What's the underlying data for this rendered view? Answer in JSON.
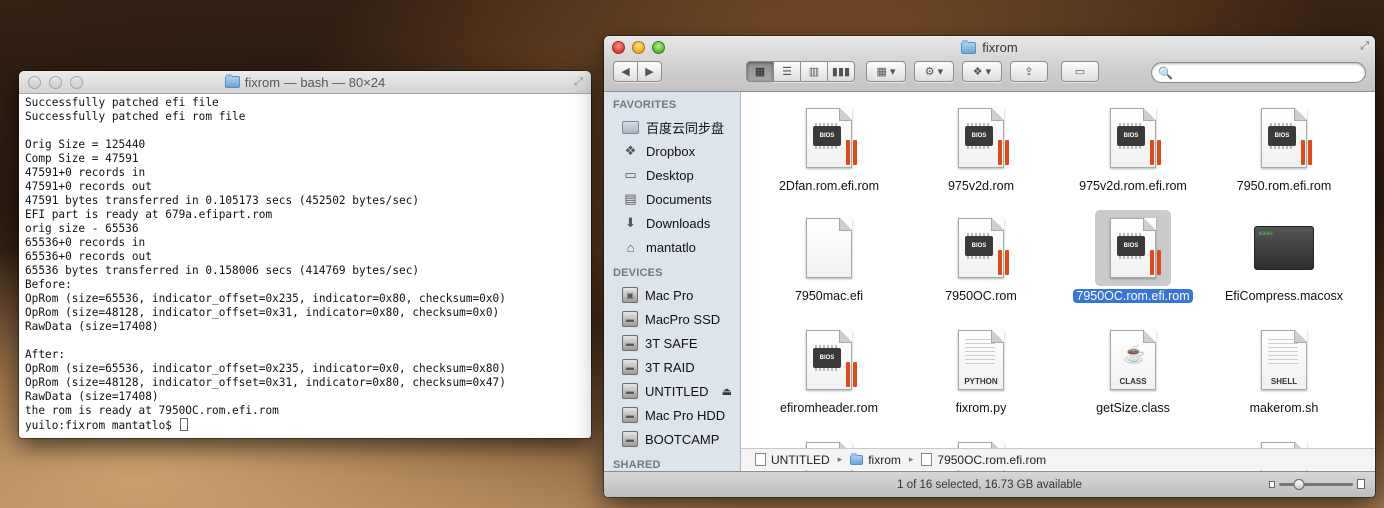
{
  "terminal": {
    "title": "fixrom — bash — 80×24",
    "lines": [
      "Successfully patched efi file",
      "Successfully patched efi rom file",
      "",
      "Orig Size = 125440",
      "Comp Size = 47591",
      "47591+0 records in",
      "47591+0 records out",
      "47591 bytes transferred in 0.105173 secs (452502 bytes/sec)",
      "EFI part is ready at 679a.efipart.rom",
      "orig size - 65536",
      "65536+0 records in",
      "65536+0 records out",
      "65536 bytes transferred in 0.158006 secs (414769 bytes/sec)",
      "Before:",
      "OpRom (size=65536, indicator_offset=0x235, indicator=0x80, checksum=0x0)",
      "OpRom (size=48128, indicator_offset=0x31, indicator=0x80, checksum=0x0)",
      "RawData (size=17408)",
      "",
      "After:",
      "OpRom (size=65536, indicator_offset=0x235, indicator=0x0, checksum=0x80)",
      "OpRom (size=48128, indicator_offset=0x31, indicator=0x80, checksum=0x47)",
      "RawData (size=17408)",
      "the rom is ready at 7950OC.rom.efi.rom"
    ],
    "prompt": "yuilo:fixrom mantatlo$ "
  },
  "finder": {
    "title": "fixrom",
    "search_placeholder": "",
    "sidebar": {
      "favorites_label": "FAVORITES",
      "favorites": [
        {
          "label": "百度云同步盘",
          "icon": "folder-icon"
        },
        {
          "label": "Dropbox",
          "icon": "dropbox-icon"
        },
        {
          "label": "Desktop",
          "icon": "desktop-icon"
        },
        {
          "label": "Documents",
          "icon": "documents-icon"
        },
        {
          "label": "Downloads",
          "icon": "downloads-icon"
        },
        {
          "label": "mantatlo",
          "icon": "home-icon"
        }
      ],
      "devices_label": "DEVICES",
      "devices": [
        {
          "label": "Mac Pro",
          "icon": "computer-icon"
        },
        {
          "label": "MacPro SSD",
          "icon": "disk-icon"
        },
        {
          "label": "3T SAFE",
          "icon": "disk-icon"
        },
        {
          "label": "3T RAID",
          "icon": "disk-icon"
        },
        {
          "label": "UNTITLED",
          "icon": "disk-icon"
        },
        {
          "label": "Mac Pro HDD",
          "icon": "disk-icon"
        },
        {
          "label": "BOOTCAMP",
          "icon": "disk-icon"
        }
      ],
      "shared_label": "SHARED"
    },
    "files": [
      {
        "name": "2Dfan.rom.efi.rom",
        "type": "bios",
        "selected": false
      },
      {
        "name": "975v2d.rom",
        "type": "bios",
        "selected": false
      },
      {
        "name": "975v2d.rom.efi.rom",
        "type": "bios",
        "selected": false
      },
      {
        "name": "7950.rom.efi.rom",
        "type": "bios",
        "selected": false
      },
      {
        "name": "7950mac.efi",
        "type": "blank",
        "selected": false
      },
      {
        "name": "7950OC.rom",
        "type": "bios",
        "selected": false
      },
      {
        "name": "7950OC.rom.efi.rom",
        "type": "bios",
        "selected": true
      },
      {
        "name": "EfiCompress.macosx",
        "type": "exec",
        "selected": false
      },
      {
        "name": "efiromheader.rom",
        "type": "bios",
        "selected": false
      },
      {
        "name": "fixrom.py",
        "type": "python",
        "selected": false
      },
      {
        "name": "getSize.class",
        "type": "class",
        "selected": false
      },
      {
        "name": "makerom.sh",
        "type": "shell",
        "selected": false
      }
    ],
    "icon_text": {
      "bios": "BIOS",
      "python": "PYTHON",
      "class": "CLASS",
      "shell": "SHELL",
      "exec": "exec"
    },
    "path": [
      "UNTITLED",
      "fixrom",
      "7950OC.rom.efi.rom"
    ],
    "status": "1 of 16 selected, 16.73 GB available",
    "icon_size_level": 0.27
  }
}
